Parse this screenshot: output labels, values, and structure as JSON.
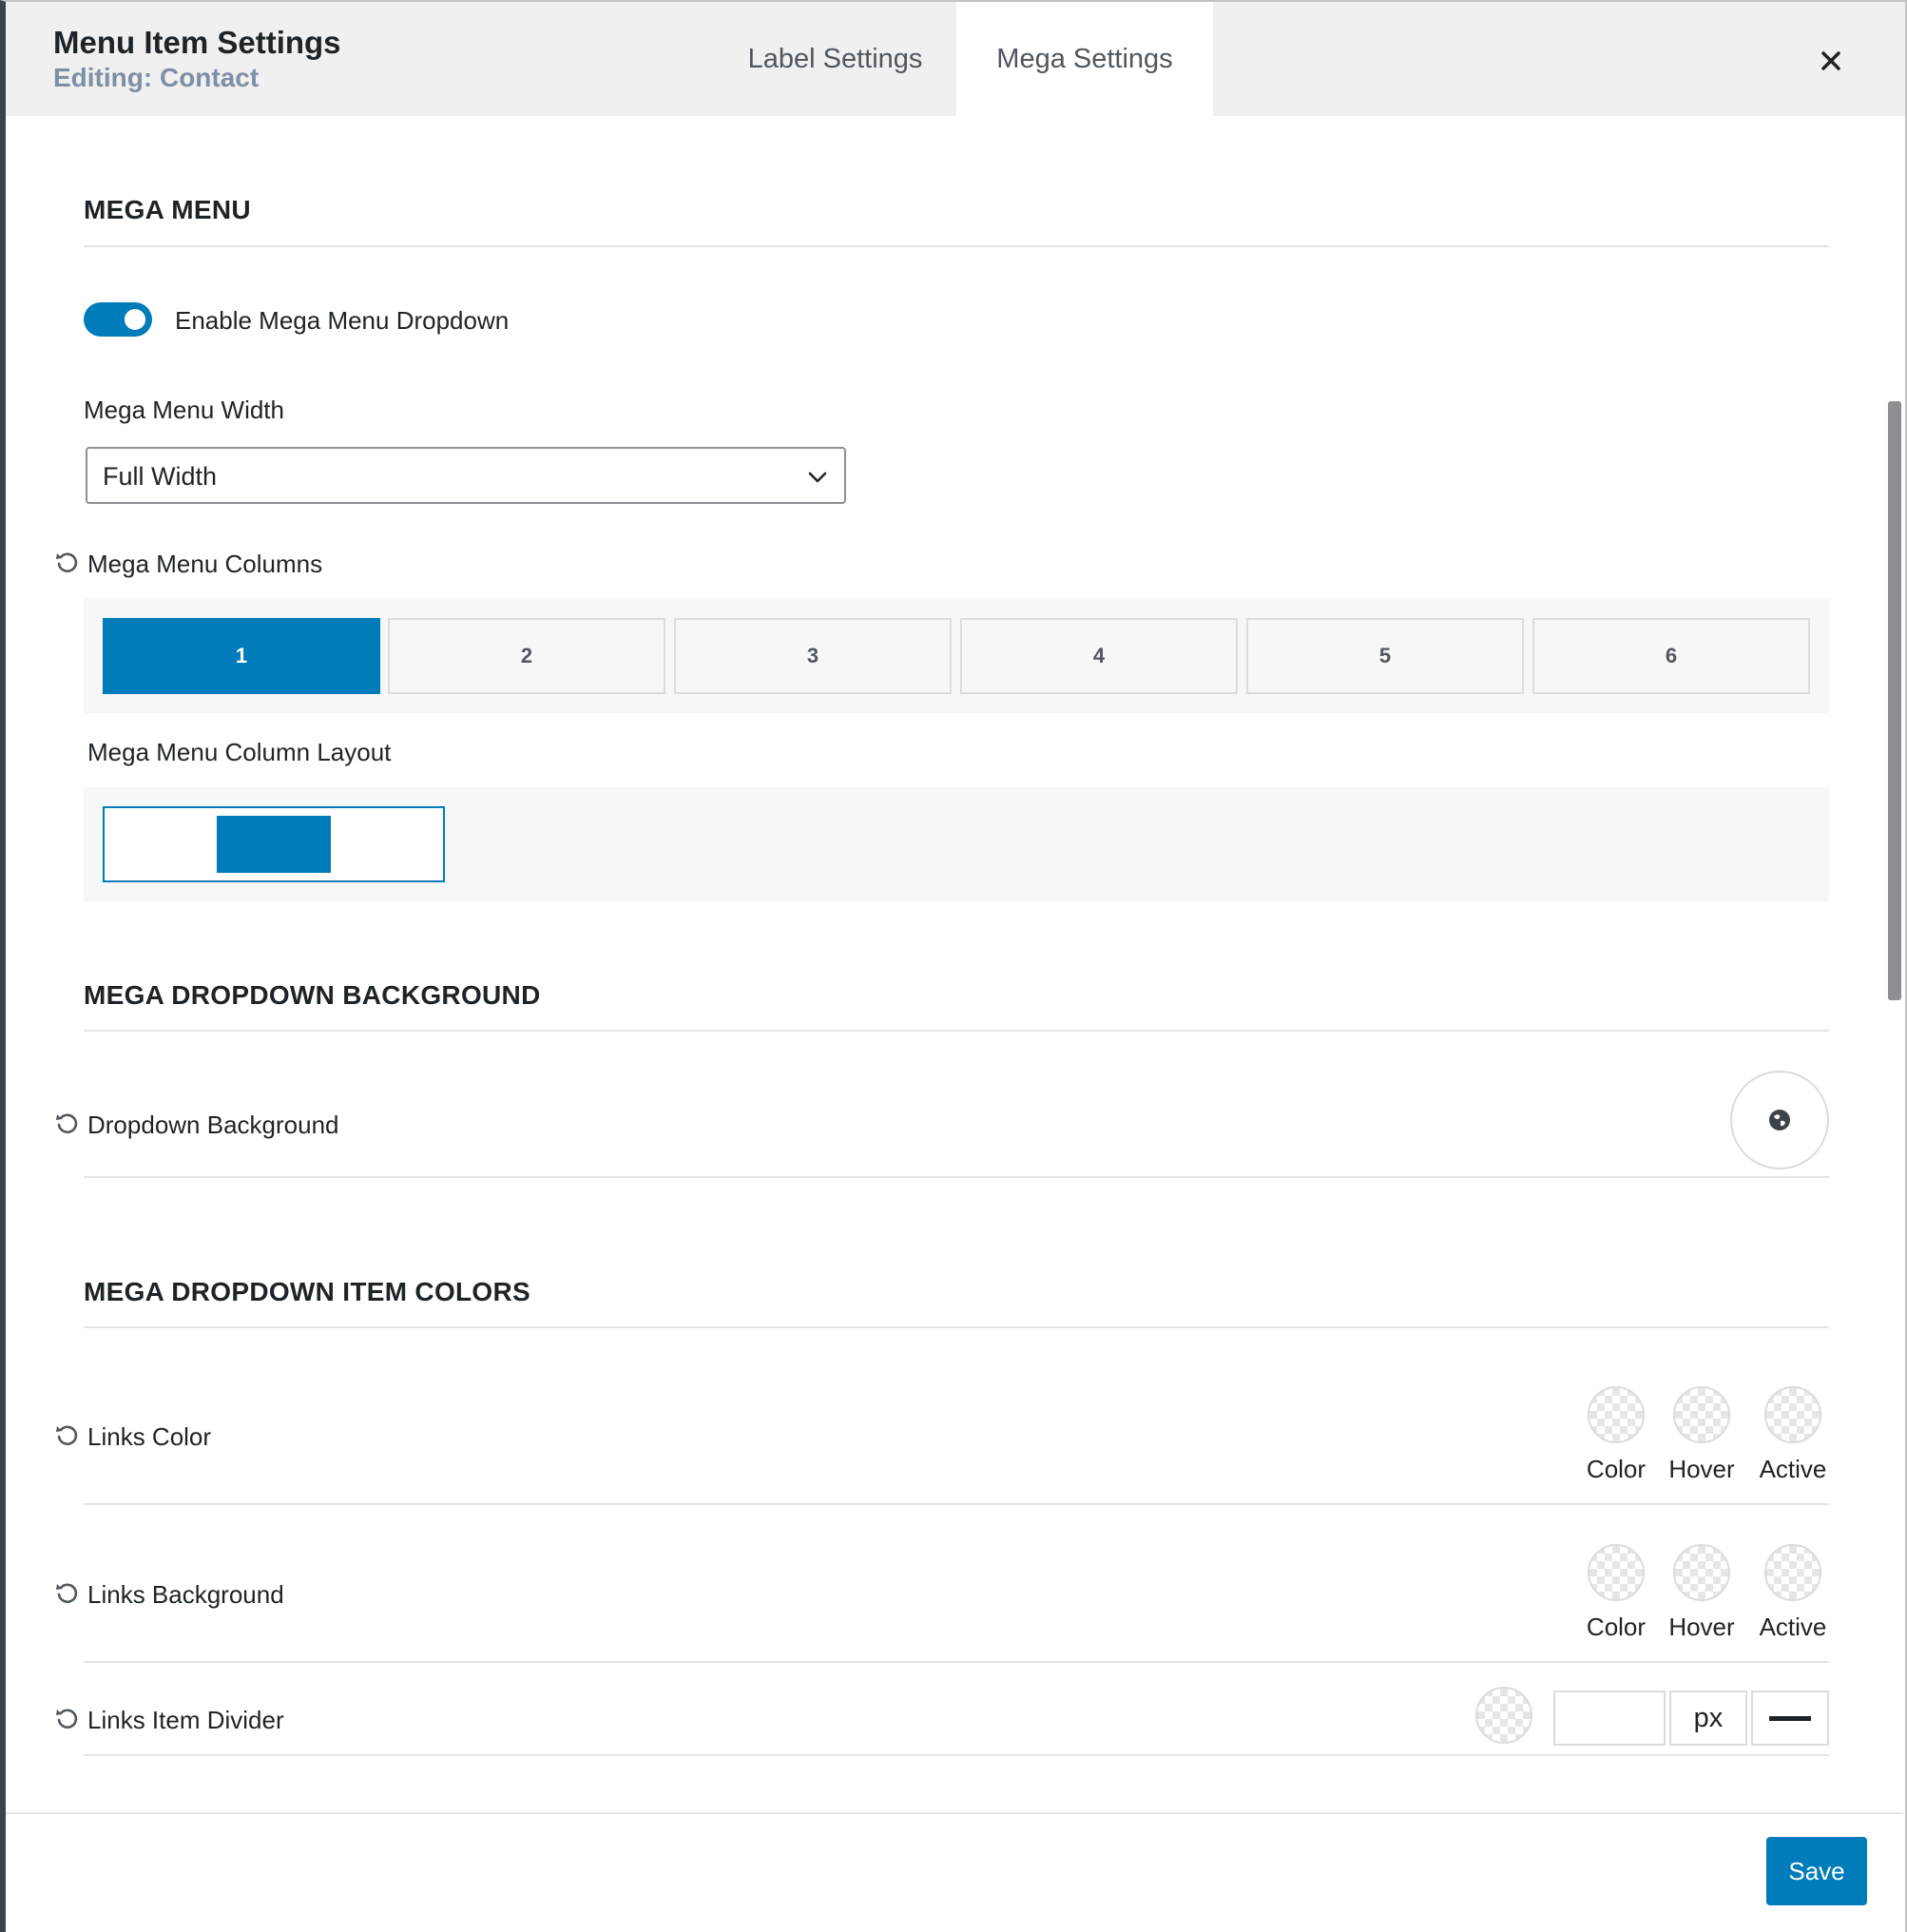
{
  "header": {
    "title": "Menu Item Settings",
    "subtitle": "Editing: Contact",
    "tabs": [
      {
        "label": "Label Settings",
        "active": false
      },
      {
        "label": "Mega Settings",
        "active": true
      }
    ],
    "close_icon": "close-icon"
  },
  "mega_menu": {
    "section_title": "MEGA MENU",
    "enable_label": "Enable Mega Menu Dropdown",
    "enable_value": true,
    "width_label": "Mega Menu Width",
    "width_value": "Full Width",
    "columns_label": "Mega Menu Columns",
    "columns": [
      "1",
      "2",
      "3",
      "4",
      "5",
      "6"
    ],
    "columns_selected": "1",
    "layout_label": "Mega Menu Column Layout"
  },
  "background": {
    "section_title": "MEGA DROPDOWN BACKGROUND",
    "dropdown_bg_label": "Dropdown Background",
    "picker_icon": "globe-icon"
  },
  "item_colors": {
    "section_title": "MEGA DROPDOWN ITEM COLORS",
    "links_color": {
      "label": "Links Color",
      "states": [
        "Color",
        "Hover",
        "Active"
      ]
    },
    "links_background": {
      "label": "Links Background",
      "states": [
        "Color",
        "Hover",
        "Active"
      ]
    },
    "links_divider": {
      "label": "Links Item Divider",
      "width_value": "",
      "unit": "px",
      "line_style": "solid"
    }
  },
  "footer": {
    "save_label": "Save"
  },
  "colors": {
    "accent": "#007cba",
    "header_bg": "#f0f0f1",
    "subtitle": "#7e8fa6"
  }
}
